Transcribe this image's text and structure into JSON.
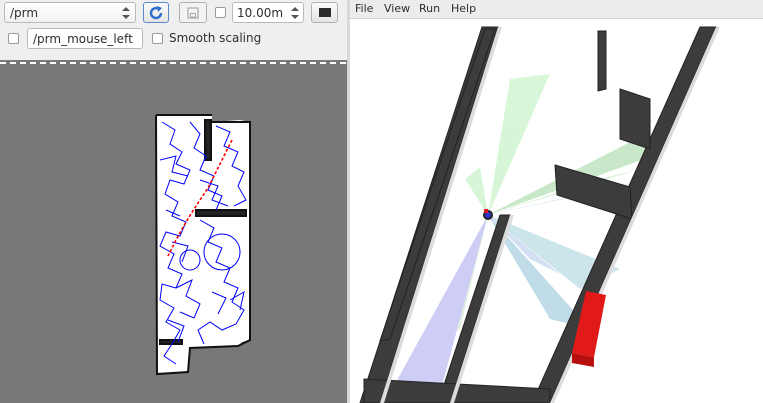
{
  "left_panel": {
    "topic_select": {
      "value": "/prm"
    },
    "scale_input": {
      "value": "10.00m"
    },
    "mouse_topic_input": {
      "value": "/prm_mouse_left"
    },
    "smooth_scaling": {
      "label": "Smooth scaling",
      "checked": false
    },
    "refresh_icon": "refresh-icon",
    "save_icon": "save-icon",
    "stop_icon": "stop-icon"
  },
  "right_panel": {
    "menu": [
      "File",
      "View",
      "Run",
      "Help"
    ]
  },
  "colors": {
    "panel_bg": "#efefef",
    "map_unknown": "#787878",
    "map_free": "#ffffff",
    "roadmap_edges": "#0000ff",
    "path": "#ff0000",
    "wall": "#3c3c3c",
    "floor": "#ffffff",
    "laser_cone": "#9ec8ee",
    "robot_body": "#e11919"
  }
}
